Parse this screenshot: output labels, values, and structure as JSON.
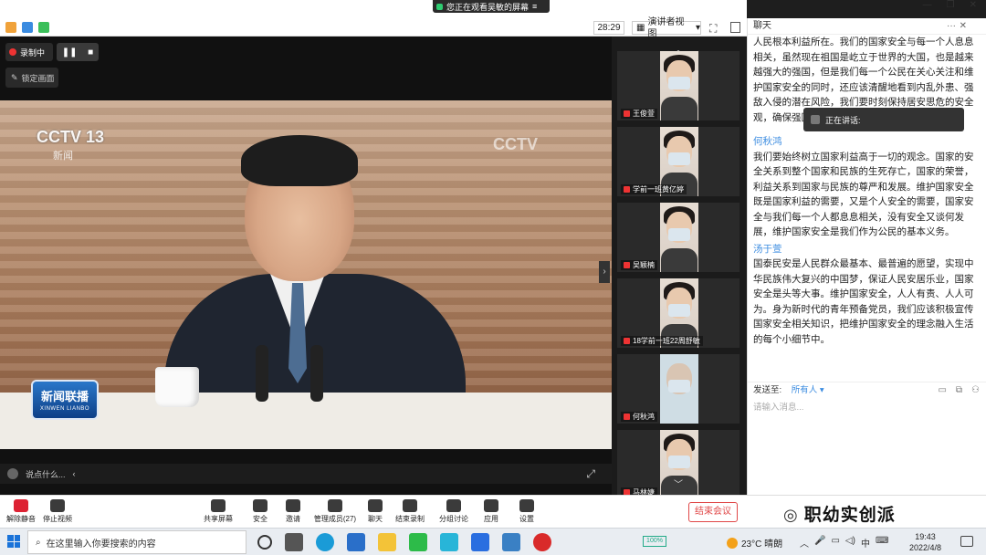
{
  "share_banner": "您正在观看吴敏的屏幕",
  "timer": "28:29",
  "view_mode": "演讲者视图",
  "recording": {
    "label": "录制中"
  },
  "lock_screen": "锁定画面",
  "video": {
    "channel": "CCTV 13",
    "channel_sub": "新闻",
    "badge": "新闻联播",
    "badge_sub": "XINWEN LIANBO",
    "caption": "说点什么..."
  },
  "participants": [
    {
      "name": "王俊萱"
    },
    {
      "name": "学前一班黄亿婷"
    },
    {
      "name": "吴颖楠"
    },
    {
      "name": "18学前一班22周舒敏"
    },
    {
      "name": "何秋鸿"
    },
    {
      "name": "马林婕"
    }
  ],
  "chat": {
    "title": "聊天",
    "speaking_label": "正在讲话:",
    "messages": [
      {
        "sender": "",
        "text": "人民根本利益所在。我们的国家安全与每一个人息息相关，虽然现在祖国是屹立于世界的大国，也是越来越强大的强国，但是我们每一个公民在关心关注和维护国家安全的同时，还应该清醒地看到内乱外患、强敌入侵的潜在风险，我们要时刻保持居安思危的安全观，确保强国梦、强军梦"
      },
      {
        "sender": "何秋鸿",
        "text": "我们要始终树立国家利益高于一切的观念。国家的安全关系到整个国家和民族的生死存亡，国家的荣誉，利益关系到国家与民族的尊严和发展。维护国家安全既是国家利益的需要，又是个人安全的需要，国家安全与我们每一个人都息息相关，没有安全又谈何发展，维护国家安全是我们作为公民的基本义务。"
      },
      {
        "sender": "汤于萱",
        "text": "国泰民安是人民群众最基本、最普遍的愿望，实现中华民族伟大复兴的中国梦，保证人民安居乐业，国家安全是头等大事。维护国家安全，人人有责、人人可为。身为新时代的青年预备党员，我们应该积极宣传国家安全相关知识，把维护国家安全的理念融入生活的每个小细节中。"
      }
    ],
    "send_to_label": "发送至:",
    "send_to_value": "所有人",
    "input_placeholder": "请输入消息..."
  },
  "toolbar": {
    "mute": "解除静音",
    "stop_video": "停止视频",
    "share_screen": "共享屏幕",
    "security": "安全",
    "invite": "邀请",
    "participants": "管理成员(27)",
    "chat": "聊天",
    "end_record": "结束录制",
    "breakout": "分组讨论",
    "apps": "应用",
    "settings": "设置",
    "end_meeting": "结束会议"
  },
  "watermark": "职幼实创派",
  "taskbar": {
    "search_placeholder": "在这里输入你要搜索的内容",
    "battery": "100%",
    "weather": "23°C 晴朗",
    "ime": "中",
    "time": "19:43",
    "date": "2022/4/8"
  }
}
